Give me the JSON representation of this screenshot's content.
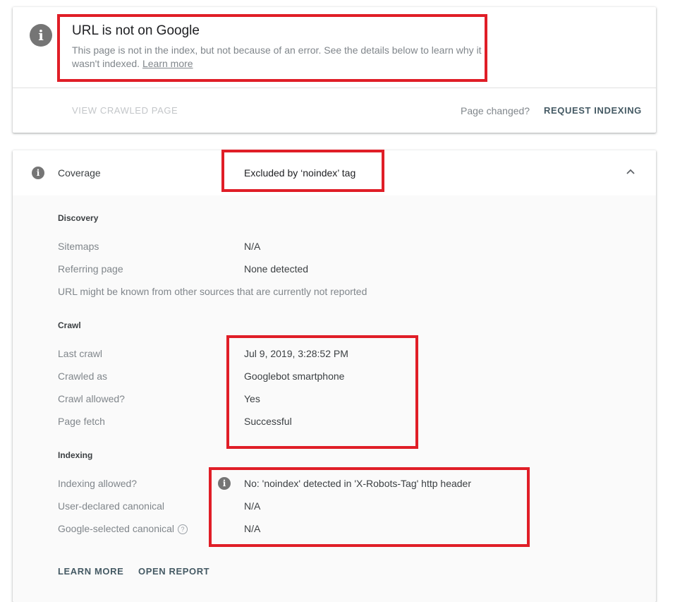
{
  "status": {
    "title": "URL is not on Google",
    "description": "This page is not in the index, but not because of an error. See the details below to learn why it wasn't indexed.",
    "learn_more_link": "Learn more",
    "view_crawled_label": "VIEW CRAWLED PAGE",
    "page_changed_text": "Page changed?",
    "request_indexing_label": "REQUEST INDEXING",
    "icon": "info-icon"
  },
  "coverage": {
    "label": "Coverage",
    "value": "Excluded by ‘noindex’ tag",
    "icon": "info-icon",
    "toggle_icon": "chevron-up-icon",
    "discovery": {
      "heading": "Discovery",
      "rows": [
        {
          "label": "Sitemaps",
          "value": "N/A"
        },
        {
          "label": "Referring page",
          "value": "None detected"
        }
      ],
      "note": "URL might be known from other sources that are currently not reported"
    },
    "crawl": {
      "heading": "Crawl",
      "rows": [
        {
          "label": "Last crawl",
          "value": "Jul 9, 2019, 3:28:52 PM"
        },
        {
          "label": "Crawled as",
          "value": "Googlebot smartphone"
        },
        {
          "label": "Crawl allowed?",
          "value": "Yes"
        },
        {
          "label": "Page fetch",
          "value": "Successful"
        }
      ]
    },
    "indexing": {
      "heading": "Indexing",
      "rows": [
        {
          "label": "Indexing allowed?",
          "value": "No: 'noindex' detected in 'X-Robots-Tag' http header"
        },
        {
          "label": "User-declared canonical",
          "value": "N/A"
        },
        {
          "label": "Google-selected canonical",
          "value": "N/A"
        }
      ]
    },
    "footer": {
      "learn_more_label": "LEARN MORE",
      "open_report_label": "OPEN REPORT"
    }
  },
  "colors": {
    "highlight": "#e01e27",
    "action": "#455a64",
    "muted_text": "#80868b",
    "icon_gray": "#757575"
  }
}
